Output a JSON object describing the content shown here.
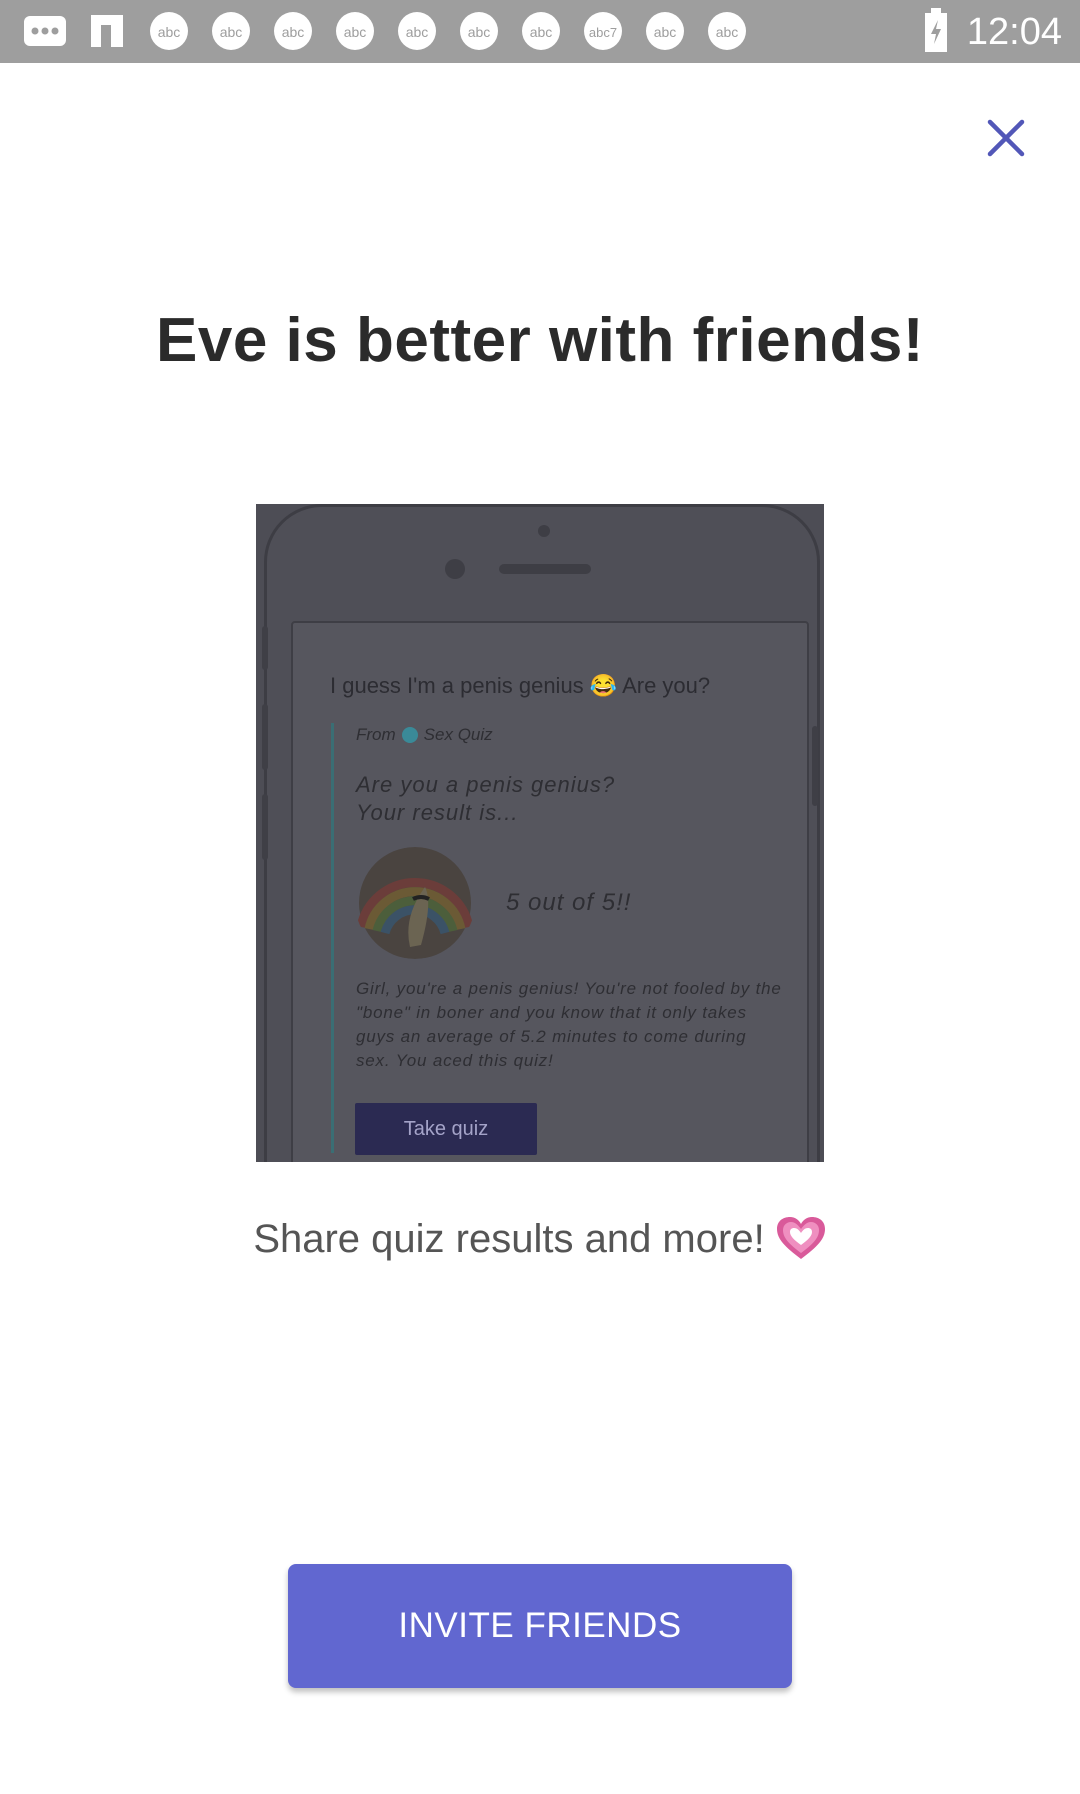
{
  "status_bar": {
    "time": "12:04",
    "left_icons": [
      "more-icon",
      "flipboard-icon",
      "abc-icon",
      "abc-icon",
      "abc-icon",
      "abc-icon",
      "abc-icon",
      "abc-icon",
      "abc-icon",
      "abc7-icon",
      "abc-icon",
      "abc-icon"
    ],
    "right_icons": [
      "battery-icon"
    ]
  },
  "close": {
    "icon": "close-icon",
    "color": "#5257b8"
  },
  "title": "Eve is better with friends!",
  "preview": {
    "message": "I guess I'm a penis genius 😂 Are you?",
    "from_prefix": "From",
    "from_source": "Sex Quiz",
    "question_line1": "Are you a penis genius?",
    "question_line2": "Your result is...",
    "result": "5 out of 5!!",
    "description": "Girl, you're a penis genius! You're not fooled by the \"bone\" in boner and you know that it only takes guys an average of 5.2 minutes to come during sex. You aced this quiz!",
    "button": "Take quiz"
  },
  "subtitle": "Share quiz results and more!",
  "subtitle_icon": "heart-icon",
  "invite_button": {
    "label": "INVITE FRIENDS",
    "color": "#6167d0"
  }
}
